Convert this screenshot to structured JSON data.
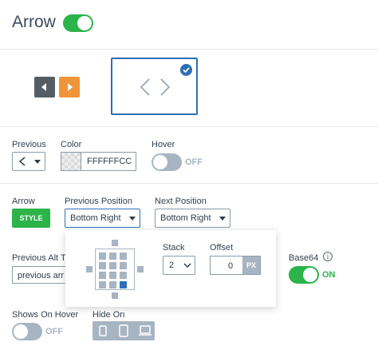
{
  "header": {
    "title": "Arrow",
    "toggle_on": true
  },
  "preview": {
    "selected": true
  },
  "row1": {
    "previous_label": "Previous",
    "color_label": "Color",
    "color_value": "FFFFFFCC",
    "hover_label": "Hover",
    "hover_state": "OFF"
  },
  "row2": {
    "arrow_label": "Arrow",
    "style_button": "STYLE",
    "prev_position_label": "Previous Position",
    "prev_position_value": "Bottom Right",
    "next_position_label": "Next Position",
    "next_position_value": "Bottom Right"
  },
  "popup": {
    "stack_label": "Stack",
    "stack_value": "2",
    "offset_label": "Offset",
    "offset_value": "0",
    "offset_unit": "PX"
  },
  "row3": {
    "prev_alt_label": "Previous Alt T",
    "prev_alt_value": "previous arr",
    "base64_label": "Base64",
    "base64_state": "ON"
  },
  "row4": {
    "shows_on_hover_label": "Shows On Hover",
    "shows_on_hover_state": "OFF",
    "hide_on_label": "Hide On",
    "hide_on_icons": [
      "phone-icon",
      "tablet-icon",
      "laptop-icon"
    ]
  },
  "colors": {
    "accent": "#2cb34a",
    "blue": "#2c6fb6",
    "orange": "#f0943a",
    "dark": "#555c63"
  }
}
